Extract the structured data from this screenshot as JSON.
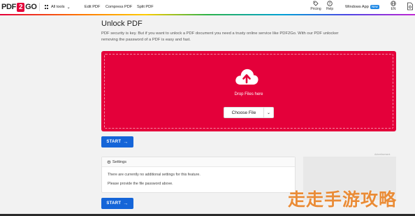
{
  "header": {
    "logo_left": "PDF",
    "logo_mid": "2",
    "logo_right": "GO",
    "all_tools_label": "All tools",
    "nav": {
      "edit_label": "Edit PDF",
      "compress_label": "Compress PDF",
      "split_label": "Split PDF"
    },
    "printing_label": "Pricing",
    "help_label": "Help",
    "windows_app_label": "Windows App",
    "new_badge": "New",
    "language_label": "EN"
  },
  "main": {
    "title": "Unlock PDF",
    "intro_line1": "PDF security is key. But if you want to unlock a PDF document you need a trusty online service like PDF2Go. With our PDF unlocker",
    "intro_line2": "removing the password of a PDF is easy and fast.",
    "dropzone": {
      "drop_text": "Drop Files here",
      "choose_label": "Choose File"
    },
    "start_label": "START",
    "settings": {
      "title": "Settings",
      "text1": "There are currently no additional settings for this feature.",
      "text2": "Please provide the file password above."
    },
    "ad_label": "Advertisement"
  },
  "watermark": "走走手游攻略",
  "colors": {
    "accent_red": "#e4003a",
    "primary_blue": "#1565d8",
    "badge_blue": "#1e88e5"
  },
  "icons": {
    "all_tools": "grid-icon",
    "pricing": "tag-icon",
    "help": "question-icon",
    "language": "globe-icon",
    "files": "document-icon",
    "upload": "cloud-upload-icon",
    "settings": "gear-icon",
    "start": "arrow-right-icon"
  }
}
